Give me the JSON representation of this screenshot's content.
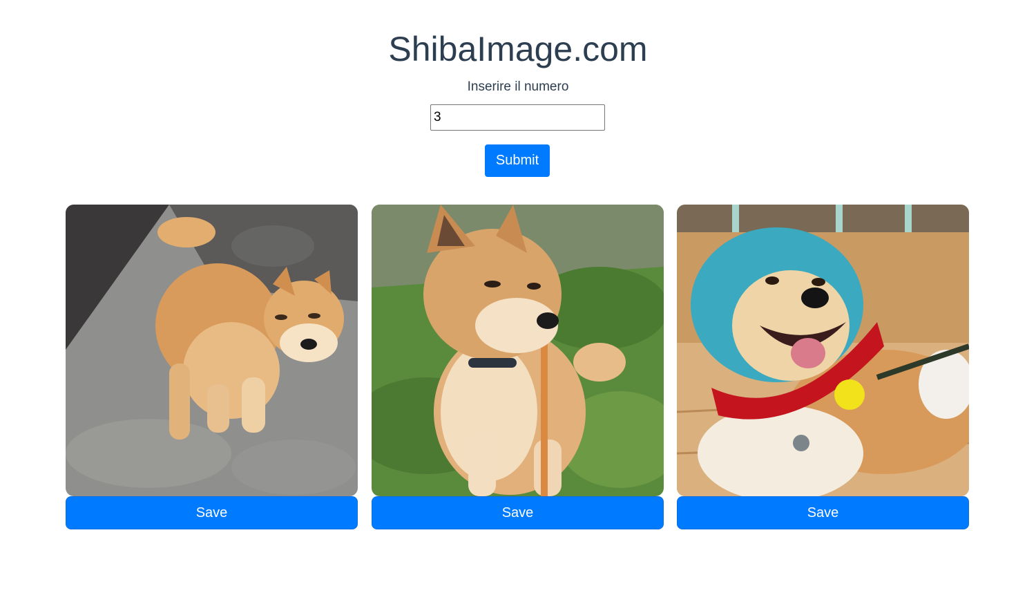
{
  "header": {
    "title": "ShibaImage.com",
    "prompt_label": "Inserire il numero"
  },
  "form": {
    "number_value": "3",
    "submit_label": "Submit"
  },
  "gallery": {
    "cards": [
      {
        "image": "shiba-dog-on-pavement",
        "save_label": "Save"
      },
      {
        "image": "shiba-dog-on-grass",
        "save_label": "Save"
      },
      {
        "image": "shiba-dog-in-blue-hat",
        "save_label": "Save"
      }
    ]
  },
  "colors": {
    "accent": "#007bff",
    "text": "#2c3e50"
  }
}
